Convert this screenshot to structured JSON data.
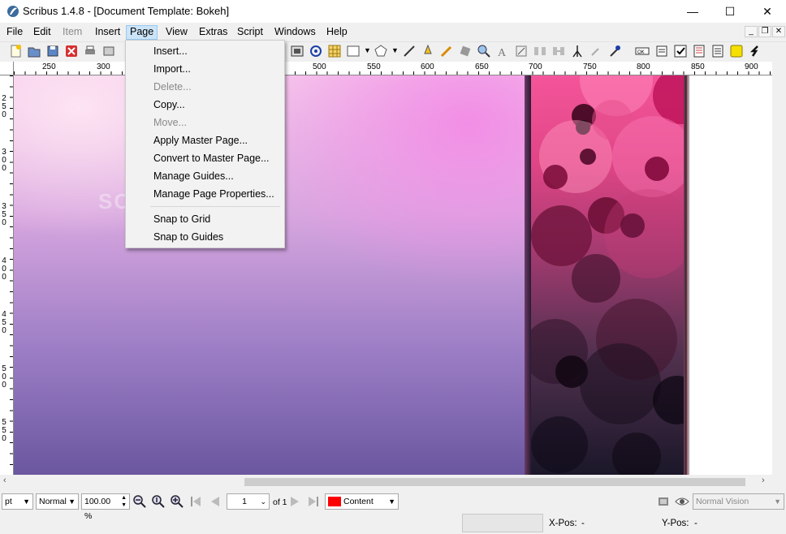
{
  "window": {
    "title": "Scribus 1.4.8 - [Document Template: Bokeh]",
    "minimize_glyph": "—",
    "maximize_glyph": "☐",
    "close_glyph": "✕"
  },
  "menubar": {
    "items": [
      {
        "label": "File",
        "disabled": false
      },
      {
        "label": "Edit",
        "disabled": false
      },
      {
        "label": "Item",
        "disabled": true
      },
      {
        "label": "Insert",
        "disabled": false
      },
      {
        "label": "Page",
        "disabled": false,
        "active": true
      },
      {
        "label": "View",
        "disabled": false
      },
      {
        "label": "Extras",
        "disabled": false
      },
      {
        "label": "Script",
        "disabled": false
      },
      {
        "label": "Windows",
        "disabled": false
      },
      {
        "label": "Help",
        "disabled": false
      }
    ],
    "mdi": {
      "minimize": "_",
      "restore": "❐",
      "close": "✕"
    }
  },
  "page_menu": {
    "items": [
      {
        "label": "Insert...",
        "disabled": false
      },
      {
        "label": "Import...",
        "disabled": false
      },
      {
        "label": "Delete...",
        "disabled": true
      },
      {
        "label": "Copy...",
        "disabled": false
      },
      {
        "label": "Move...",
        "disabled": true
      },
      {
        "label": "Apply Master Page...",
        "disabled": false
      },
      {
        "label": "Convert to Master Page...",
        "disabled": false
      },
      {
        "label": "Manage Guides...",
        "disabled": false
      },
      {
        "label": "Manage Page Properties...",
        "disabled": false
      },
      {
        "label": "Snap to Grid",
        "disabled": false
      },
      {
        "label": "Snap to Guides",
        "disabled": false
      }
    ]
  },
  "ruler": {
    "h_labels": [
      "250",
      "300",
      "500",
      "550",
      "600",
      "650",
      "700",
      "750",
      "800",
      "850",
      "900"
    ],
    "v_labels": [
      [
        "2",
        "5",
        "0"
      ],
      [
        "3",
        "0",
        "0"
      ],
      [
        "3",
        "5",
        "0"
      ],
      [
        "4",
        "0",
        "0"
      ],
      [
        "4",
        "5",
        "0"
      ],
      [
        "5",
        "0",
        "0"
      ],
      [
        "5",
        "5",
        "0"
      ]
    ]
  },
  "statusbar": {
    "unit": "pt",
    "quality": "Normal",
    "zoom": "100.00 %",
    "page_current": "1",
    "page_of": "of 1",
    "layer": "Content",
    "layer_color": "#ff0000",
    "vision": "Normal Vision",
    "xpos_label": "X-Pos:",
    "xpos_value": "-",
    "ypos_label": "Y-Pos:",
    "ypos_value": "-"
  },
  "watermark": "SOFTPEDIA",
  "colors": {
    "accent_menu": "#cce4f7",
    "bokeh_pink": "#f4559a"
  }
}
